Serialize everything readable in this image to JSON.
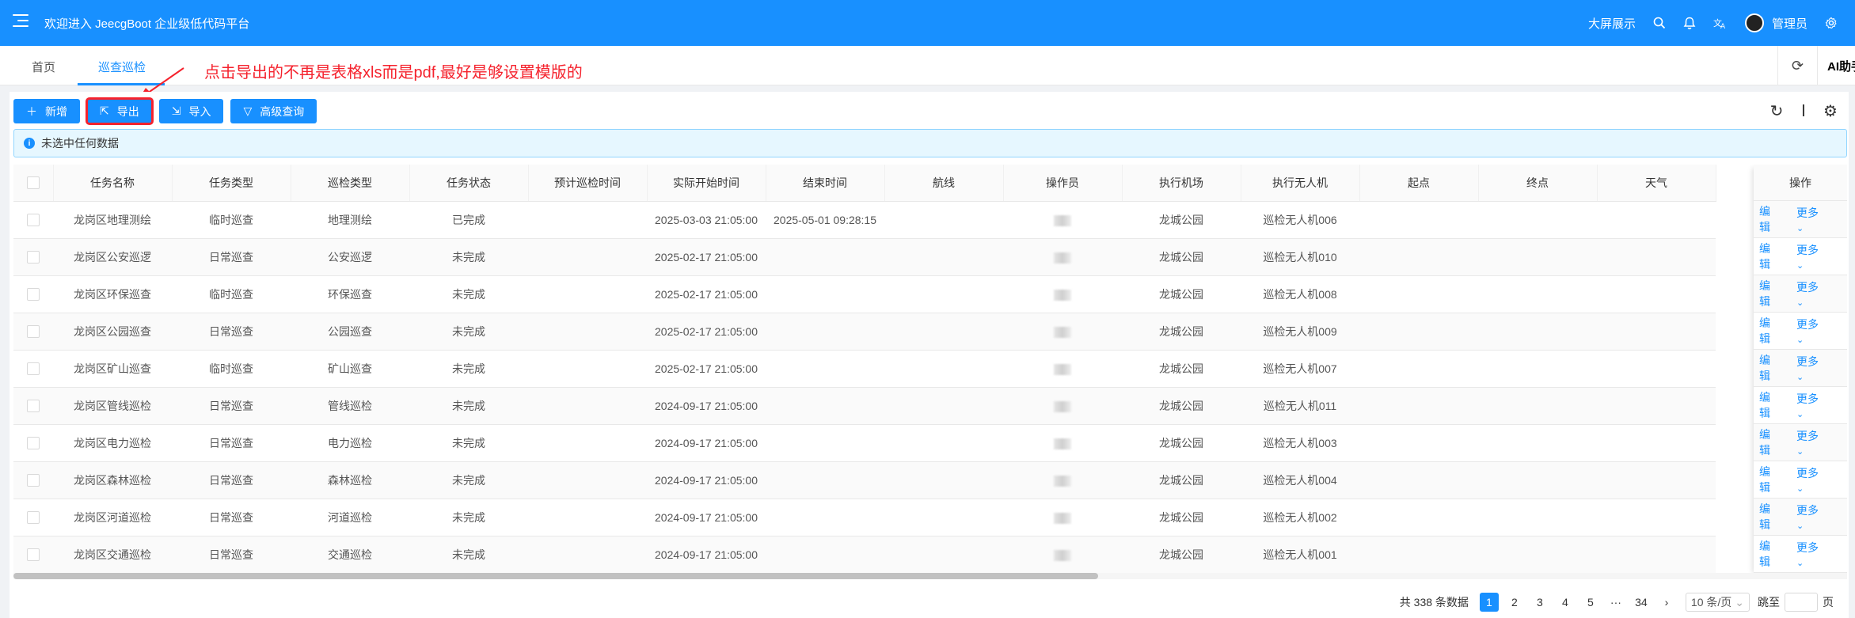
{
  "header": {
    "title": "欢迎进入 JeecgBoot 企业级低代码平台",
    "big_screen": "大屏展示",
    "user_name": "管理员",
    "icons": [
      "menu-icon",
      "search-icon",
      "bell-icon",
      "translate-icon",
      "settings-icon"
    ]
  },
  "tabs": [
    {
      "label": "首页"
    },
    {
      "label": "巡查巡检",
      "active": true
    }
  ],
  "tab_tools": {
    "ai_label": "AI助手"
  },
  "annotation": "点击导出的不再是表格xls而是pdf,最好是够设置模版的",
  "toolbar": {
    "add_label": "新增",
    "export_label": "导出",
    "import_label": "导入",
    "advanced_label": "高级查询"
  },
  "alert": "未选中任何数据",
  "table": {
    "columns": [
      "任务名称",
      "任务类型",
      "巡检类型",
      "任务状态",
      "预计巡检时间",
      "实际开始时间",
      "结束时间",
      "航线",
      "操作员",
      "执行机场",
      "执行无人机",
      "起点",
      "终点",
      "天气"
    ],
    "op_header": "操作",
    "op_edit": "编辑",
    "op_more": "更多",
    "rows": [
      {
        "name": "龙岗区地理测绘",
        "task_type": "临时巡查",
        "patrol_type": "地理测绘",
        "status": "已完成",
        "planned": "",
        "start": "2025-03-03 21:05:00",
        "end": "2025-05-01 09:28:15",
        "route": "",
        "airport": "龙城公园",
        "drone": "巡检无人机006",
        "origin": "",
        "dest": "",
        "weather": ""
      },
      {
        "name": "龙岗区公安巡逻",
        "task_type": "日常巡查",
        "patrol_type": "公安巡逻",
        "status": "未完成",
        "planned": "",
        "start": "2025-02-17 21:05:00",
        "end": "",
        "route": "",
        "airport": "龙城公园",
        "drone": "巡检无人机010",
        "origin": "",
        "dest": "",
        "weather": ""
      },
      {
        "name": "龙岗区环保巡查",
        "task_type": "临时巡查",
        "patrol_type": "环保巡查",
        "status": "未完成",
        "planned": "",
        "start": "2025-02-17 21:05:00",
        "end": "",
        "route": "",
        "airport": "龙城公园",
        "drone": "巡检无人机008",
        "origin": "",
        "dest": "",
        "weather": ""
      },
      {
        "name": "龙岗区公园巡查",
        "task_type": "日常巡查",
        "patrol_type": "公园巡查",
        "status": "未完成",
        "planned": "",
        "start": "2025-02-17 21:05:00",
        "end": "",
        "route": "",
        "airport": "龙城公园",
        "drone": "巡检无人机009",
        "origin": "",
        "dest": "",
        "weather": ""
      },
      {
        "name": "龙岗区矿山巡查",
        "task_type": "临时巡查",
        "patrol_type": "矿山巡查",
        "status": "未完成",
        "planned": "",
        "start": "2025-02-17 21:05:00",
        "end": "",
        "route": "",
        "airport": "龙城公园",
        "drone": "巡检无人机007",
        "origin": "",
        "dest": "",
        "weather": ""
      },
      {
        "name": "龙岗区管线巡检",
        "task_type": "日常巡查",
        "patrol_type": "管线巡检",
        "status": "未完成",
        "planned": "",
        "start": "2024-09-17 21:05:00",
        "end": "",
        "route": "",
        "airport": "龙城公园",
        "drone": "巡检无人机011",
        "origin": "",
        "dest": "",
        "weather": ""
      },
      {
        "name": "龙岗区电力巡检",
        "task_type": "日常巡查",
        "patrol_type": "电力巡检",
        "status": "未完成",
        "planned": "",
        "start": "2024-09-17 21:05:00",
        "end": "",
        "route": "",
        "airport": "龙城公园",
        "drone": "巡检无人机003",
        "origin": "",
        "dest": "",
        "weather": ""
      },
      {
        "name": "龙岗区森林巡检",
        "task_type": "日常巡查",
        "patrol_type": "森林巡检",
        "status": "未完成",
        "planned": "",
        "start": "2024-09-17 21:05:00",
        "end": "",
        "route": "",
        "airport": "龙城公园",
        "drone": "巡检无人机004",
        "origin": "",
        "dest": "",
        "weather": ""
      },
      {
        "name": "龙岗区河道巡检",
        "task_type": "日常巡查",
        "patrol_type": "河道巡检",
        "status": "未完成",
        "planned": "",
        "start": "2024-09-17 21:05:00",
        "end": "",
        "route": "",
        "airport": "龙城公园",
        "drone": "巡检无人机002",
        "origin": "",
        "dest": "",
        "weather": ""
      },
      {
        "name": "龙岗区交通巡检",
        "task_type": "日常巡查",
        "patrol_type": "交通巡检",
        "status": "未完成",
        "planned": "",
        "start": "2024-09-17 21:05:00",
        "end": "",
        "route": "",
        "airport": "龙城公园",
        "drone": "巡检无人机001",
        "origin": "",
        "dest": "",
        "weather": ""
      }
    ]
  },
  "pagination": {
    "total": "共 338 条数据",
    "pages": [
      "1",
      "2",
      "3",
      "4",
      "5",
      "···",
      "34"
    ],
    "current": "1",
    "page_size": "10 条/页",
    "goto_label": "跳至",
    "page_suffix": "页"
  },
  "colors": {
    "primary": "#1890ff",
    "annotation": "#f5222d",
    "alert_bg": "#e6f7ff"
  }
}
